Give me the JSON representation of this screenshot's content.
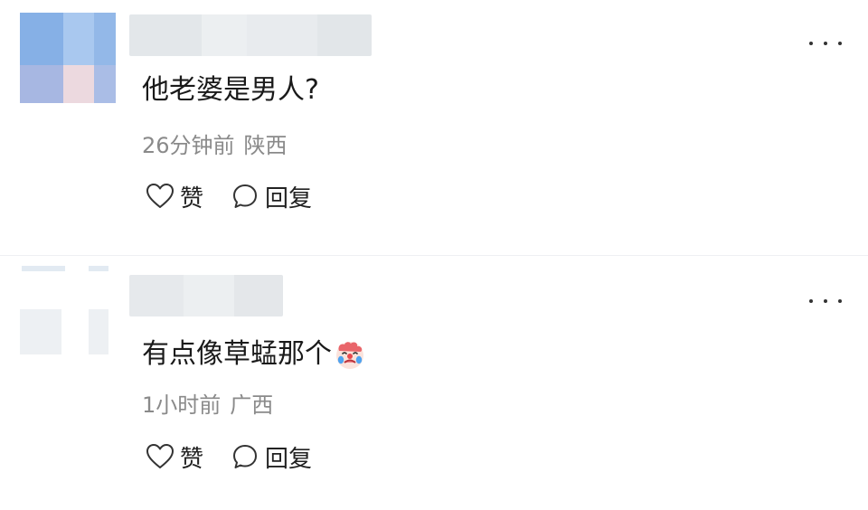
{
  "comments": [
    {
      "text": "他老婆是男人?",
      "time": "26分钟前",
      "location": "陕西",
      "like_label": "赞",
      "reply_label": "回复",
      "avatar_icon": "blurred-avatar",
      "more_icon": "more-dots-icon"
    },
    {
      "text": "有点像草蜢那个",
      "emoji_icon": "crying-clown-emoji",
      "time": "1小时前",
      "location": "广西",
      "like_label": "赞",
      "reply_label": "回复",
      "avatar_icon": "blurred-avatar",
      "more_icon": "more-dots-icon"
    }
  ],
  "colors": {
    "text": "#1a1a1a",
    "meta": "#8a8a8a",
    "avatar_blue": "#8fb6e8",
    "username_blur": "#e7ebee"
  }
}
